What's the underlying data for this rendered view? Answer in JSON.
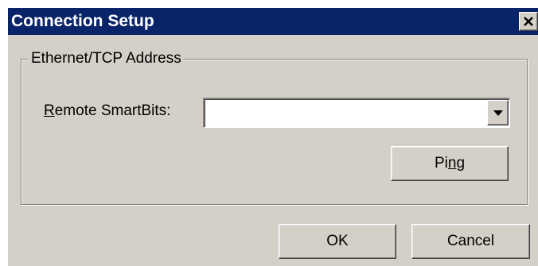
{
  "window": {
    "title": "Connection Setup",
    "close_icon": "close-icon"
  },
  "group": {
    "label": "Ethernet/TCP Address"
  },
  "remote_field": {
    "label_accel": "R",
    "label_rest": "emote SmartBits:",
    "value": "",
    "dropdown_icon": "dropdown-arrow-icon"
  },
  "buttons": {
    "ping_pre": "Pi",
    "ping_accel": "n",
    "ping_post": "g",
    "ok": "OK",
    "cancel": "Cancel"
  },
  "colors": {
    "titlebar": "#0a246a",
    "face": "#d4d0c8",
    "title_text": "#ffffff"
  }
}
